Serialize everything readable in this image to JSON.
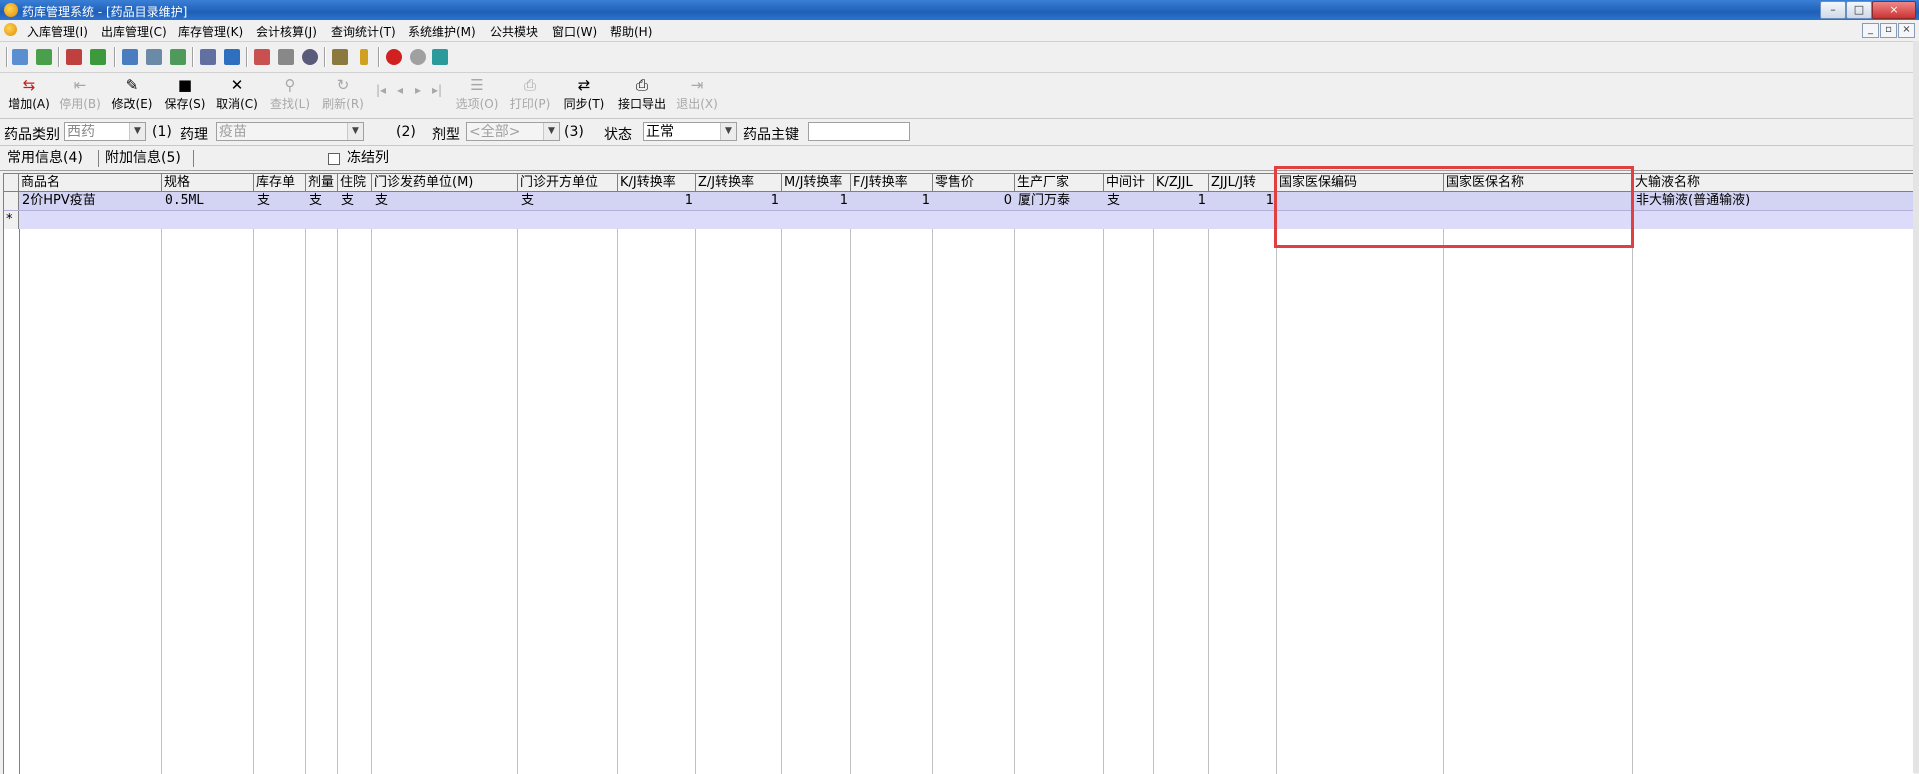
{
  "window": {
    "title": "药库管理系统 - [药品目录维护]",
    "controls": [
      "–",
      "□",
      "×"
    ]
  },
  "menu": [
    "入库管理(I)",
    "出库管理(C)",
    "库存管理(K)",
    "会计核算(J)",
    "查询统计(T)",
    "系统维护(M)",
    "公共模块",
    "窗口(W)",
    "帮助(H)"
  ],
  "mdi_controls": [
    "_",
    "▫",
    "×"
  ],
  "toolbar_icons": [
    "login-icon",
    "refresh-icon",
    "edit-doc-icon",
    "email-icon",
    "clipboard-icon",
    "report-icon",
    "list-icon",
    "form-icon",
    "print-icon",
    "doc-check-icon",
    "search-doc-icon",
    "magnifier-icon",
    "print2-icon",
    "thermometer-icon",
    "stop-icon",
    "cloud-icon",
    "calculator-icon"
  ],
  "actions": [
    {
      "label": "增加(A)",
      "glyph": "⇆",
      "enabled": true
    },
    {
      "label": "停用(B)",
      "glyph": "⇤",
      "enabled": false
    },
    {
      "label": "修改(E)",
      "glyph": "✎",
      "enabled": true
    },
    {
      "label": "保存(S)",
      "glyph": "■",
      "enabled": true
    },
    {
      "label": "取消(C)",
      "glyph": "✕",
      "enabled": true
    },
    {
      "label": "查找(L)",
      "glyph": "⚲",
      "enabled": false
    },
    {
      "label": "刷新(R)",
      "glyph": "↻",
      "enabled": false
    },
    {
      "label": "|◂",
      "glyph": "",
      "enabled": false
    },
    {
      "label": "◂",
      "glyph": "",
      "enabled": false
    },
    {
      "label": "▸",
      "glyph": "",
      "enabled": false
    },
    {
      "label": "▸|",
      "glyph": "",
      "enabled": false
    },
    {
      "label": "选项(O)",
      "glyph": "☰",
      "enabled": false
    },
    {
      "label": "打印(P)",
      "glyph": "⎙",
      "enabled": false
    },
    {
      "label": "同步(T)",
      "glyph": "⇄",
      "enabled": true
    },
    {
      "label": "接口导出",
      "glyph": "⎙",
      "enabled": true
    },
    {
      "label": "退出(X)",
      "glyph": "⇥",
      "enabled": false
    }
  ],
  "filters": {
    "category_label": "药品类别",
    "category_value": "西药",
    "category_hotkey": "(1)",
    "pharmacology_label": "药理",
    "pharmacology_value": "疫苗",
    "pharmacology_hotkey": "(2)",
    "dosage_label": "剂型",
    "dosage_value": "<全部>",
    "dosage_hotkey": "(3)",
    "status_label": "状态",
    "status_value": "正常",
    "key_label": "药品主键",
    "key_value": ""
  },
  "tabs": {
    "common": "常用信息(4)",
    "extra": "附加信息(5)",
    "freeze_label": "冻结列"
  },
  "grid": {
    "columns": [
      "商品名",
      "规格",
      "库存单",
      "剂量",
      "住院",
      "门诊发药单位(M)",
      "门诊开方单位",
      "K/J转换率",
      "Z/J转换率",
      "M/J转换率",
      "F/J转换率",
      "零售价",
      "生产厂家",
      "中间计",
      "K/ZJJL",
      "ZJJL/J转",
      "国家医保编码",
      "国家医保名称",
      "大输液名称"
    ],
    "rows": [
      [
        "2价HPV疫苗",
        "0.5ML",
        "支",
        "支",
        "支",
        "支",
        "支",
        "1",
        "1",
        "1",
        "1",
        "0",
        "厦门万泰",
        "支",
        "1",
        "1",
        "",
        "",
        "非大输液(普通输液)"
      ]
    ],
    "new_row_marker": "*"
  }
}
